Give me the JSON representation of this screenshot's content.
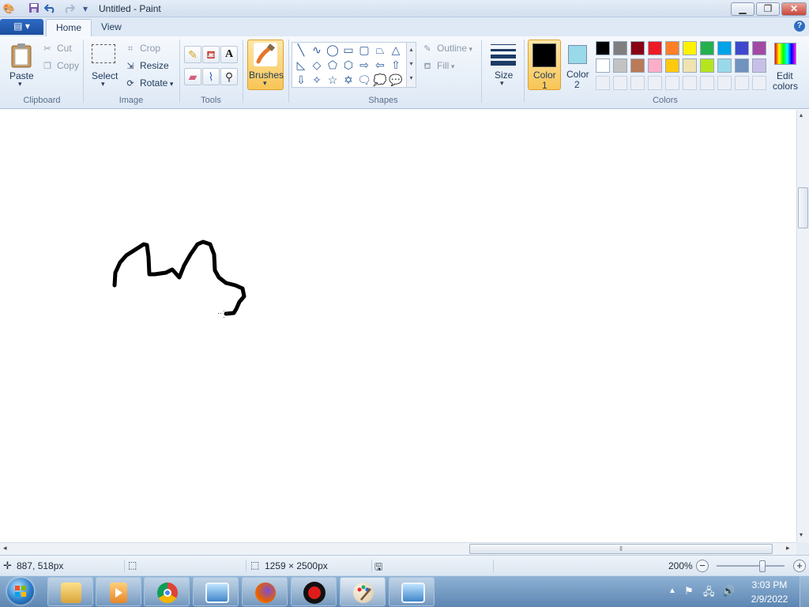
{
  "window": {
    "title": "Untitled - Paint",
    "controls": {
      "minimize": "▁",
      "maximize": "❐",
      "close": "✕"
    }
  },
  "quick_access": {
    "save_icon": "save-icon",
    "undo_icon": "undo-icon",
    "redo_icon": "redo-icon",
    "customize_icon": "dropdown-icon"
  },
  "tabs": {
    "file": "▤ ▾",
    "home": "Home",
    "view": "View",
    "help": "?"
  },
  "ribbon": {
    "clipboard": {
      "label": "Clipboard",
      "paste": "Paste",
      "cut": "Cut",
      "copy": "Copy"
    },
    "image": {
      "label": "Image",
      "select": "Select",
      "crop": "Crop",
      "resize": "Resize",
      "rotate": "Rotate"
    },
    "tools": {
      "label": "Tools",
      "icons": [
        "pencil-icon",
        "fill-icon",
        "text-icon",
        "eraser-icon",
        "color-picker-icon",
        "magnifier-icon"
      ]
    },
    "brushes": {
      "label": "Brushes"
    },
    "shapes": {
      "label": "Shapes",
      "outline": "Outline",
      "fill": "Fill",
      "items": [
        "╲",
        "∿",
        "◯",
        "▭",
        "▢",
        "⏢",
        "△",
        "◺",
        "◇",
        "⬠",
        "⬡",
        "⇨",
        "⇦",
        "⇧",
        "⇩",
        "✧",
        "☆",
        "✡",
        "🗨",
        "💭",
        "💬"
      ]
    },
    "size": {
      "label": "Size"
    },
    "color1": {
      "line1": "Color",
      "line2": "1",
      "value": "#000000"
    },
    "color2": {
      "line1": "Color",
      "line2": "2",
      "value": "#99d9ea"
    },
    "colors": {
      "label": "Colors",
      "edit_line1": "Edit",
      "edit_line2": "colors",
      "row1": [
        "#000000",
        "#7f7f7f",
        "#880015",
        "#ed1c24",
        "#ff7f27",
        "#fff200",
        "#22b14c",
        "#00a2e8",
        "#3f48cc",
        "#a349a4"
      ],
      "row2": [
        "#ffffff",
        "#c3c3c3",
        "#b97a57",
        "#ffaec9",
        "#ffc90e",
        "#efe4b0",
        "#b5e61d",
        "#99d9ea",
        "#7092be",
        "#c8bfe7"
      ],
      "row3": [
        "#ecf0f6",
        "#ecf0f6",
        "#ecf0f6",
        "#ecf0f6",
        "#ecf0f6",
        "#ecf0f6",
        "#ecf0f6",
        "#ecf0f6",
        "#ecf0f6",
        "#ecf0f6"
      ]
    }
  },
  "canvas": {
    "background": "#ffffff",
    "stroke_color": "#000000"
  },
  "status": {
    "cursor_pos": "887, 518px",
    "canvas_size": "1259 × 2500px",
    "zoom": "200%",
    "zoom_level": 0.67
  },
  "taskbar": {
    "apps": [
      "file-explorer-icon",
      "media-player-icon",
      "chrome-icon",
      "photo-viewer-icon",
      "firefox-icon",
      "screen-recorder-icon",
      "paint-icon",
      "photo-viewer-icon"
    ],
    "time": "3:03 PM",
    "date": "2/9/2022"
  }
}
